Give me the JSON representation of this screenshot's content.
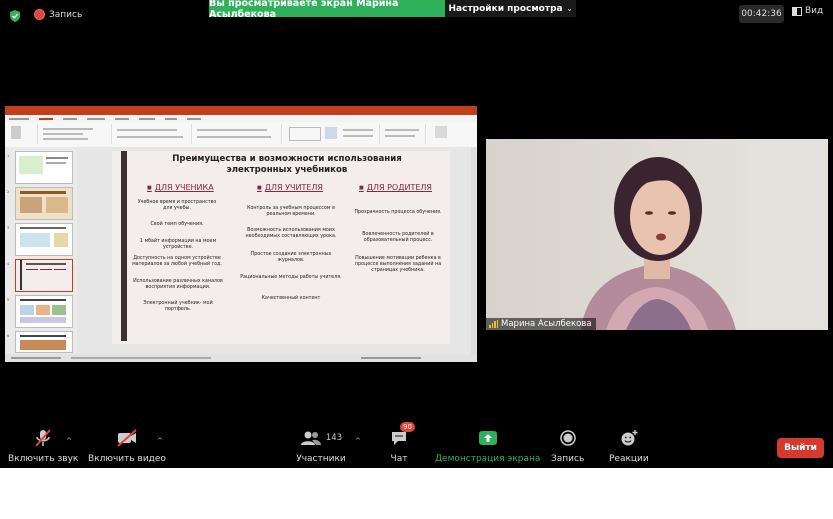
{
  "topbar": {
    "recording_label": "Запись",
    "viewing_banner": "Вы просматриваете экран Марина Асылбекова",
    "view_options_label": "Настройки просмотра",
    "timer": "00:42:36",
    "view_label": "Вид"
  },
  "shared_screen": {
    "slide": {
      "title": "Преимущества и возможности использования электронных учебников",
      "columns": [
        {
          "header": "ДЛЯ УЧЕНИКА",
          "bullets": [
            "Учебное время и пространство для учебы.",
            "Свой темп обучения.",
            "1 мбайт информации на моем устройстве.",
            "Доступность на одном устройстве материалов за любой учебный год.",
            "Использование различных каналов восприятия информации.",
            "Электронный учебник- мой портфель."
          ]
        },
        {
          "header": "ДЛЯ УЧИТЕЛЯ",
          "bullets": [
            "Контроль за учебным процессом в реальном времени.",
            "Возможность использования моих необходимых составляющих урока.",
            "Простое создание электронных журналов.",
            "Рациональные методы работы учителя.",
            "Качественный контент"
          ]
        },
        {
          "header": "ДЛЯ РОДИТЕЛЯ",
          "bullets": [
            "Прозрачность процесса обучения.",
            "Вовлеченность родителей в образовательный процесс.",
            "Повышение мотивации ребенка в процессе выполнения заданий на страницах учебника."
          ]
        }
      ]
    }
  },
  "video": {
    "participant_name": "Марина Асылбекова"
  },
  "toolbar": {
    "mute_label": "Включить звук",
    "video_label": "Включить видео",
    "participants_label": "Участники",
    "participants_count": "143",
    "chat_label": "Чат",
    "chat_badge": "90",
    "share_label": "Демонстрация экрана",
    "record_label": "Запись",
    "reactions_label": "Реакции",
    "leave_label": "Выйти"
  },
  "colors": {
    "share_green": "#2fb15b",
    "leave_red": "#d43a2e",
    "powerpoint_red": "#c43e1c",
    "slide_accent": "#8c2245"
  }
}
